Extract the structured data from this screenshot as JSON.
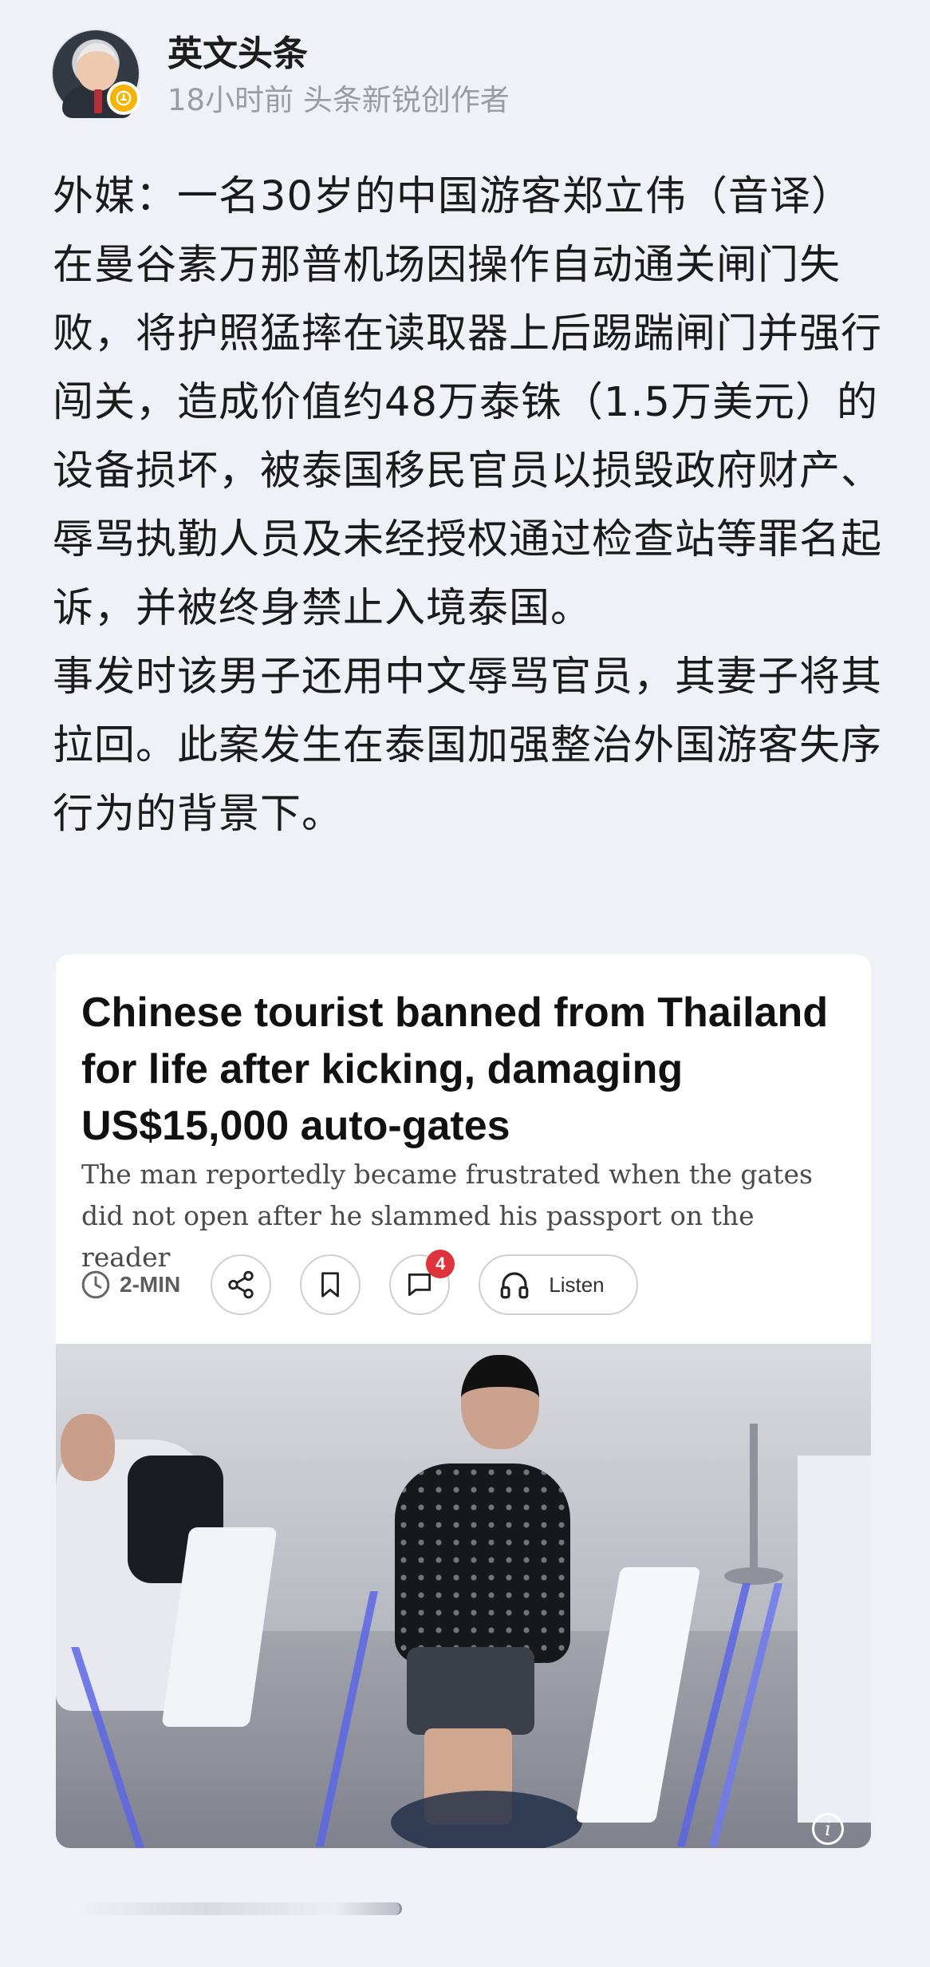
{
  "author": {
    "name": "英文头条",
    "meta": "18小时前 头条新锐创作者"
  },
  "post": {
    "paragraphs": [
      "外媒：一名30岁的中国游客郑立伟（音译）在曼谷素万那普机场因操作自动通关闸门失败，将护照猛摔在读取器上后踢踹闸门并强行闯关，造成价值约48万泰铢（1.5万美元）的设备损坏，被泰国移民官员以损毁政府财产、辱骂执勤人员及未经授权通过检查站等罪名起诉，并被终身禁止入境泰国。",
      "事发时该男子还用中文辱骂官员，其妻子将其拉回。此案发生在泰国加强整治外国游客失序行为的背景下。"
    ]
  },
  "article_card": {
    "title": "Chinese tourist banned from Thailand for life after kicking, damaging US$15,000 auto-gates",
    "subtitle": "The man reportedly became frustrated when the gates did not open after he slammed his passport on the reader",
    "read_time": "2-MIN",
    "comment_count": "4",
    "listen_label": "Listen"
  },
  "icons": {
    "clock": "clock-icon",
    "share": "share-icon",
    "bookmark": "bookmark-icon",
    "comment": "comment-icon",
    "headphones": "headphones-icon",
    "info": "info-icon",
    "verified": "verified-badge-icon"
  },
  "colors": {
    "background": "#f0f1f7",
    "badge_gold": "#f5b400",
    "comment_badge_red": "#e0323a",
    "meta_gray": "#9a9ca3"
  }
}
